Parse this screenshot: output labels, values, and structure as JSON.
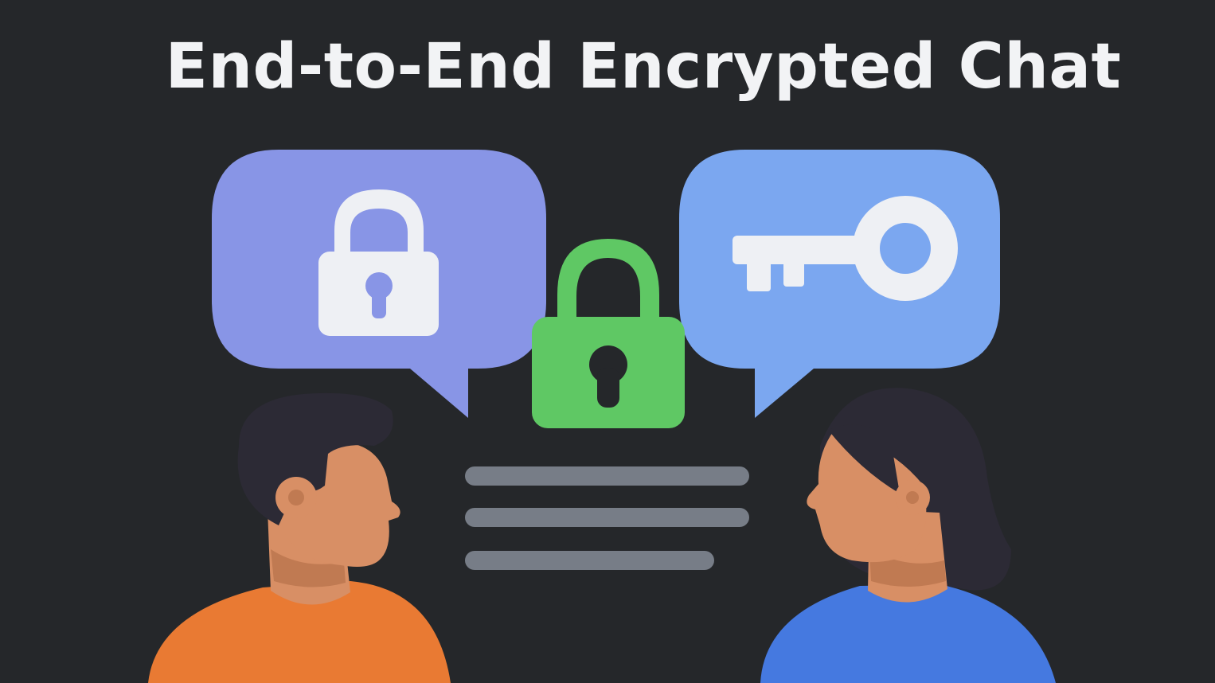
{
  "title": "End-to-End Encrypted Chat",
  "colors": {
    "background": "#25272a",
    "title_text": "#f2f3f5",
    "left_bubble": "#8895e6",
    "right_bubble": "#7ba7f0",
    "center_lock": "#5fc864",
    "message_lines": "#777d87",
    "icon_fill": "#eef0f4",
    "skin": "#d88f65",
    "skin_shadow": "#c07a52",
    "hair": "#2c2a35",
    "man_shirt": "#e97a33",
    "woman_shirt": "#4579e0"
  },
  "icons": {
    "left_bubble_icon": "padlock-icon",
    "center_icon": "padlock-icon",
    "right_bubble_icon": "key-icon"
  },
  "people": {
    "left": "man-avatar",
    "right": "woman-avatar"
  }
}
